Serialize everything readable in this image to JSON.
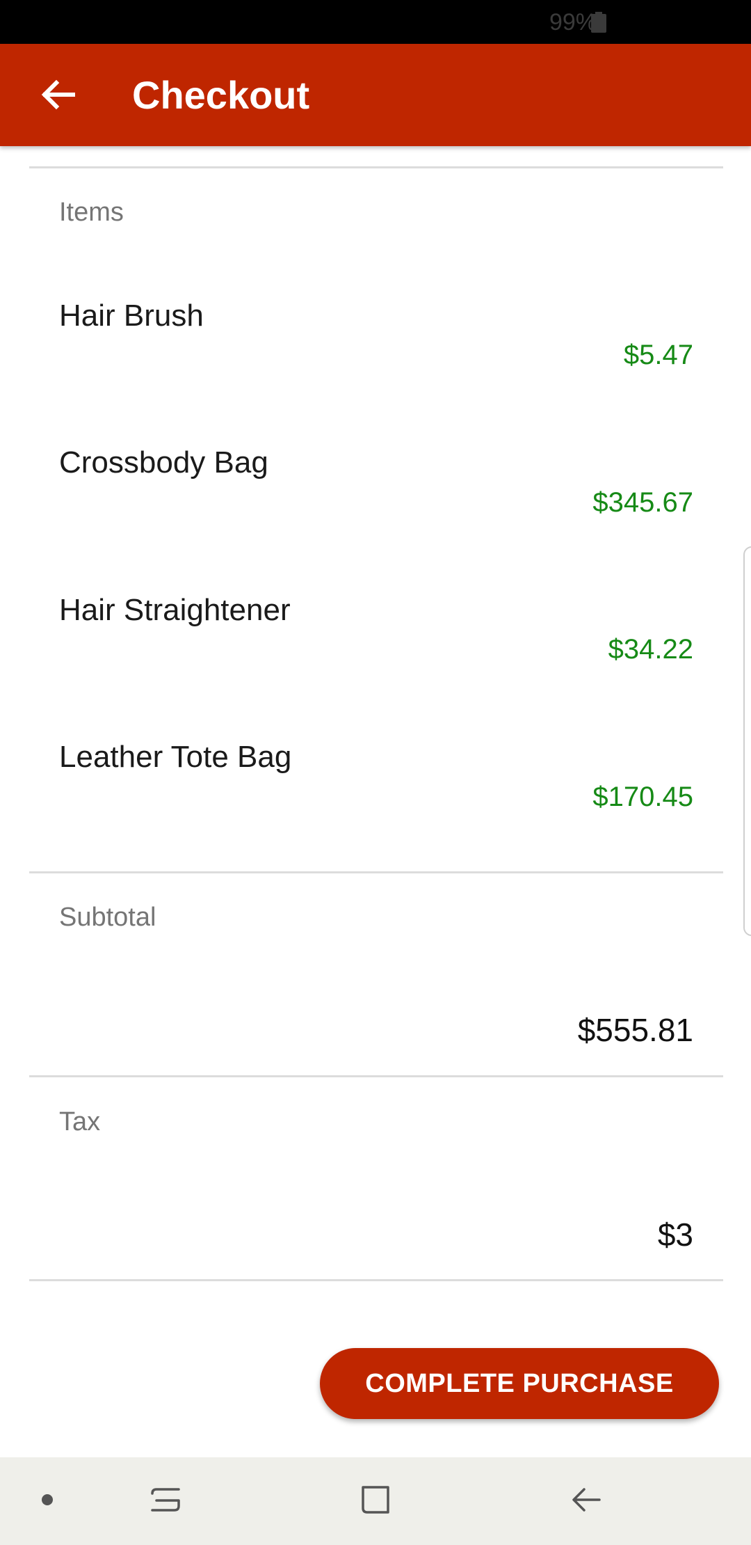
{
  "status_bar": {
    "battery_percent": "99%",
    "battery_icon": "battery-icon"
  },
  "app_bar": {
    "title": "Checkout",
    "back_icon": "arrow-back-icon",
    "background": "#bf2600"
  },
  "items_section": {
    "label": "Items",
    "items": [
      {
        "name": "Hair Brush",
        "price": "$5.47"
      },
      {
        "name": "Crossbody Bag",
        "price": "$345.67"
      },
      {
        "name": "Hair Straightener",
        "price": "$34.22"
      },
      {
        "name": "Leather Tote Bag",
        "price": "$170.45"
      }
    ],
    "price_color": "#168a16"
  },
  "subtotal": {
    "label": "Subtotal",
    "value": "$555.81"
  },
  "tax": {
    "label": "Tax",
    "value": "$3"
  },
  "actions": {
    "complete_purchase_label": "COMPLETE PURCHASE",
    "accent": "#bf2600"
  },
  "nav_bar": {
    "buttons": [
      "dot-icon",
      "recent-apps-icon",
      "home-icon",
      "back-icon"
    ]
  }
}
